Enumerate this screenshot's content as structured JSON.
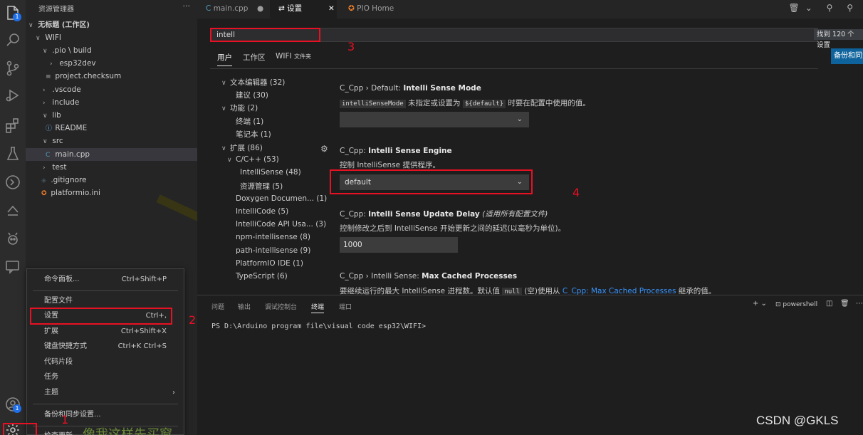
{
  "activity_bar": {
    "explorer_badge": "1",
    "account_badge": "1"
  },
  "explorer": {
    "header": "资源管理器",
    "more": "···",
    "items": [
      {
        "label": "无标题 (工作区)",
        "chev": "∨"
      },
      {
        "label": "WIFI",
        "chev": "∨"
      },
      {
        "label": ".pio \\ build",
        "chev": "∨"
      },
      {
        "label": "esp32dev",
        "chev": "›"
      },
      {
        "label": "project.checksum",
        "chev": "≡"
      },
      {
        "label": ".vscode",
        "chev": "›"
      },
      {
        "label": "include",
        "chev": "›"
      },
      {
        "label": "lib",
        "chev": "∨"
      },
      {
        "label": "README",
        "chev": "ⓘ"
      },
      {
        "label": "src",
        "chev": "∨"
      },
      {
        "label": "main.cpp",
        "chev": "C"
      },
      {
        "label": "test",
        "chev": "›"
      },
      {
        "label": ".gitignore",
        "chev": "◈"
      },
      {
        "label": "platformio.ini",
        "chev": "✪"
      }
    ]
  },
  "tabs": [
    {
      "label": "main.cpp",
      "icon": "C",
      "marker": "●"
    },
    {
      "label": "设置",
      "icon": "⇄",
      "marker": "✕"
    },
    {
      "label": "PIO Home",
      "icon": "✪",
      "marker": ""
    }
  ],
  "settings": {
    "search_value": "intell",
    "found": "找到 120 个设置",
    "sync_button": "备份和同步",
    "scopes": [
      "用户",
      "工作区",
      "WIFI"
    ],
    "scope_wifi_suffix": "文件夹",
    "toc": [
      {
        "label": "文本编辑器 (32)",
        "chev": "∨"
      },
      {
        "label": "建议 (30)",
        "chev": ""
      },
      {
        "label": "功能 (2)",
        "chev": "∨"
      },
      {
        "label": "终端 (1)",
        "chev": ""
      },
      {
        "label": "笔记本 (1)",
        "chev": ""
      },
      {
        "label": "扩展 (86)",
        "chev": "∨"
      },
      {
        "label": "C/C++ (53)",
        "chev": "∨"
      },
      {
        "label": "IntelliSense (48)",
        "chev": ""
      },
      {
        "label": "资源管理 (5)",
        "chev": ""
      },
      {
        "label": "Doxygen Documen... (1)",
        "chev": ""
      },
      {
        "label": "IntelliCode (5)",
        "chev": ""
      },
      {
        "label": "IntelliCode API Usa... (3)",
        "chev": ""
      },
      {
        "label": "npm-intellisense (8)",
        "chev": ""
      },
      {
        "label": "path-intellisense (9)",
        "chev": ""
      },
      {
        "label": "PlatformIO IDE (1)",
        "chev": ""
      },
      {
        "label": "TypeScript (6)",
        "chev": ""
      }
    ],
    "s1": {
      "prefix": "C_Cpp › Default: ",
      "name": "Intelli Sense Mode",
      "code": "intelliSenseMode",
      "desc_mid": " 未指定或设置为 ",
      "code2": "${default}",
      "desc_end": " 时要在配置中使用的值。",
      "value": ""
    },
    "s2": {
      "prefix": "C_Cpp: ",
      "name": "Intelli Sense Engine",
      "desc": "控制 IntelliSense 提供程序。",
      "value": "default"
    },
    "s3": {
      "prefix": "C_Cpp: ",
      "name": "Intelli Sense Update Delay",
      "scope_note": "(适用所有配置文件)",
      "desc": "控制修改之后到 IntelliSense 开始更新之间的延迟(以毫秒为单位)。",
      "value": "1000"
    },
    "s4": {
      "prefix": "C_Cpp › Intelli Sense: ",
      "name": "Max Cached Processes",
      "desc_start": "要继续运行的最大 IntelliSense 进程数。默认值 ",
      "code": "null",
      "desc_mid": " (空)使用从 ",
      "link": "C_Cpp: Max Cached Processes",
      "desc_end": " 继承的值。"
    }
  },
  "panel": {
    "tabs": [
      "问题",
      "输出",
      "调试控制台",
      "终端",
      "端口"
    ],
    "shell": "powershell",
    "terminal_line": "PS D:\\Arduino program file\\visual code esp32\\WIFI>"
  },
  "menu": {
    "items": [
      {
        "label": "命令面板...",
        "key": "Ctrl+Shift+P"
      },
      {
        "label": "配置文件",
        "key": ""
      },
      {
        "label": "设置",
        "key": "Ctrl+,"
      },
      {
        "label": "扩展",
        "key": "Ctrl+Shift+X"
      },
      {
        "label": "键盘快捷方式",
        "key": "Ctrl+K Ctrl+S"
      },
      {
        "label": "代码片段",
        "key": ""
      },
      {
        "label": "任务",
        "key": ""
      },
      {
        "label": "主题",
        "key": "›"
      },
      {
        "label": "备份和同步设置...",
        "key": ""
      }
    ],
    "cut_item": "检查更新..."
  },
  "annotations": {
    "n1": "1",
    "n2": "2",
    "n3": "3",
    "n4": "4",
    "handwriting": "像我这样先买窗.."
  },
  "watermark": "CSDN @GKLS"
}
